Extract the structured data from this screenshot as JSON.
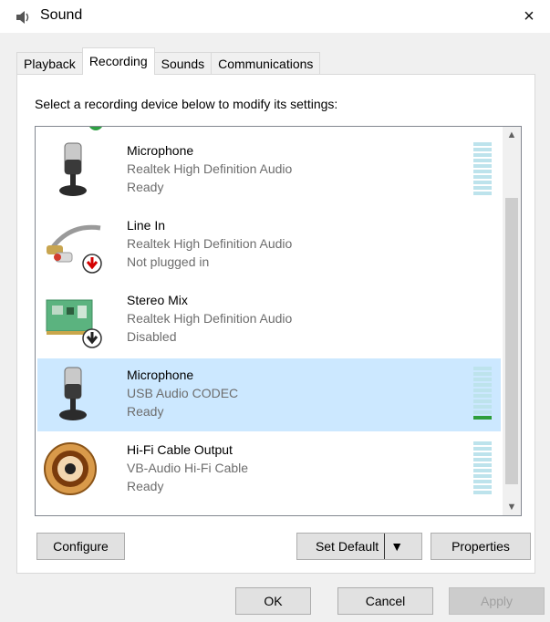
{
  "window": {
    "title": "Sound",
    "close_glyph": "×",
    "icon": "speaker-icon"
  },
  "tabs": [
    {
      "label": "Playback"
    },
    {
      "label": "Recording",
      "active": true
    },
    {
      "label": "Sounds"
    },
    {
      "label": "Communications"
    }
  ],
  "instruction": "Select a recording device below to modify its settings:",
  "devices": [
    {
      "name": "Microphone",
      "description": "Realtek High Definition Audio",
      "status": "Ready",
      "icon": "microphone-icon",
      "level": 0
    },
    {
      "name": "Line In",
      "description": "Realtek High Definition Audio",
      "status": "Not plugged in",
      "icon": "line-in-icon",
      "badge": "not-plugged-in-badge-icon",
      "level": null
    },
    {
      "name": "Stereo Mix",
      "description": "Realtek High Definition Audio",
      "status": "Disabled",
      "icon": "stereo-mix-icon",
      "badge": "disabled-badge-icon",
      "level": null
    },
    {
      "name": "Microphone",
      "description": "USB Audio CODEC",
      "status": "Ready",
      "icon": "microphone-icon",
      "selected": true,
      "level": 0.1
    },
    {
      "name": "Hi-Fi Cable Output",
      "description": "VB-Audio Hi-Fi Cable",
      "status": "Ready",
      "icon": "rca-jack-icon",
      "level": 0
    }
  ],
  "buttons": {
    "configure": "Configure",
    "set_default": "Set Default",
    "properties": "Properties",
    "ok": "OK",
    "cancel": "Cancel",
    "apply": "Apply"
  },
  "colors": {
    "selection": "#cce8ff",
    "level_active": "#2e9e3a",
    "level_idle": "#bde3ec"
  }
}
